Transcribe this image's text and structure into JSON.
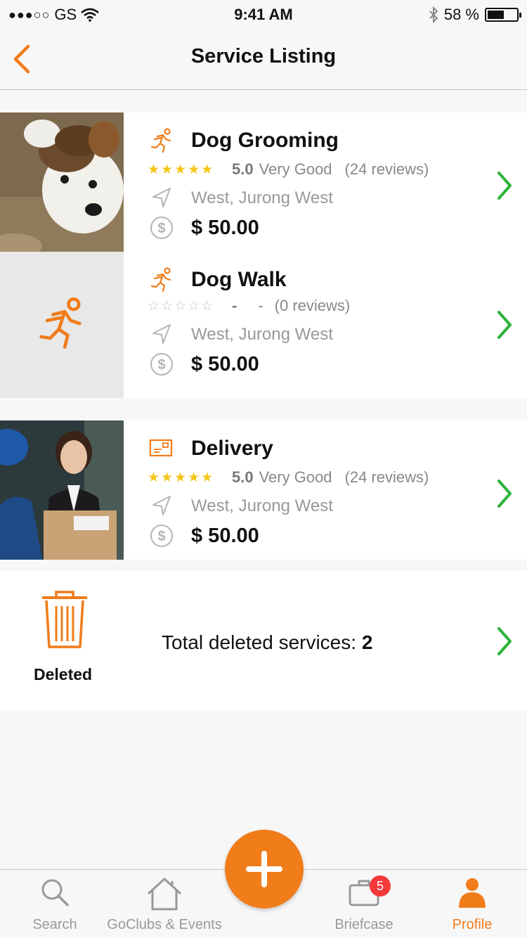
{
  "status_bar": {
    "carrier": "GS",
    "signal_dots": "●●●○○",
    "time": "9:41 AM",
    "battery_percent": "58 %",
    "battery_level": 0.58
  },
  "nav": {
    "title": "Service Listing"
  },
  "listings": [
    {
      "title": "Dog Grooming",
      "stars": "★★★★★",
      "score": "5.0",
      "rating_label": "Very Good",
      "reviews": "(24 reviews)",
      "location": "West, Jurong West",
      "price": "$ 50.00"
    },
    {
      "title": "Dog Walk",
      "stars": "☆☆☆☆☆",
      "score": "-",
      "rating_label": "-",
      "reviews": "(0 reviews)",
      "location": "West, Jurong West",
      "price": "$ 50.00"
    },
    {
      "title": "Delivery",
      "stars": "★★★★★",
      "score": "5.0",
      "rating_label": "Very Good",
      "reviews": "(24 reviews)",
      "location": "West, Jurong West",
      "price": "$ 50.00"
    }
  ],
  "deleted": {
    "label": "Deleted",
    "text": "Total deleted services:",
    "count": "2"
  },
  "tab_bar": {
    "tabs": [
      "Search",
      "GoClubs & Events",
      "Briefcase",
      "Profile"
    ],
    "active": "Profile",
    "briefcase_badge": "5"
  },
  "colors": {
    "accent": "#f07c1a",
    "chevron": "#2bb33a",
    "star": "#f5c518",
    "badge": "#f5393a"
  }
}
